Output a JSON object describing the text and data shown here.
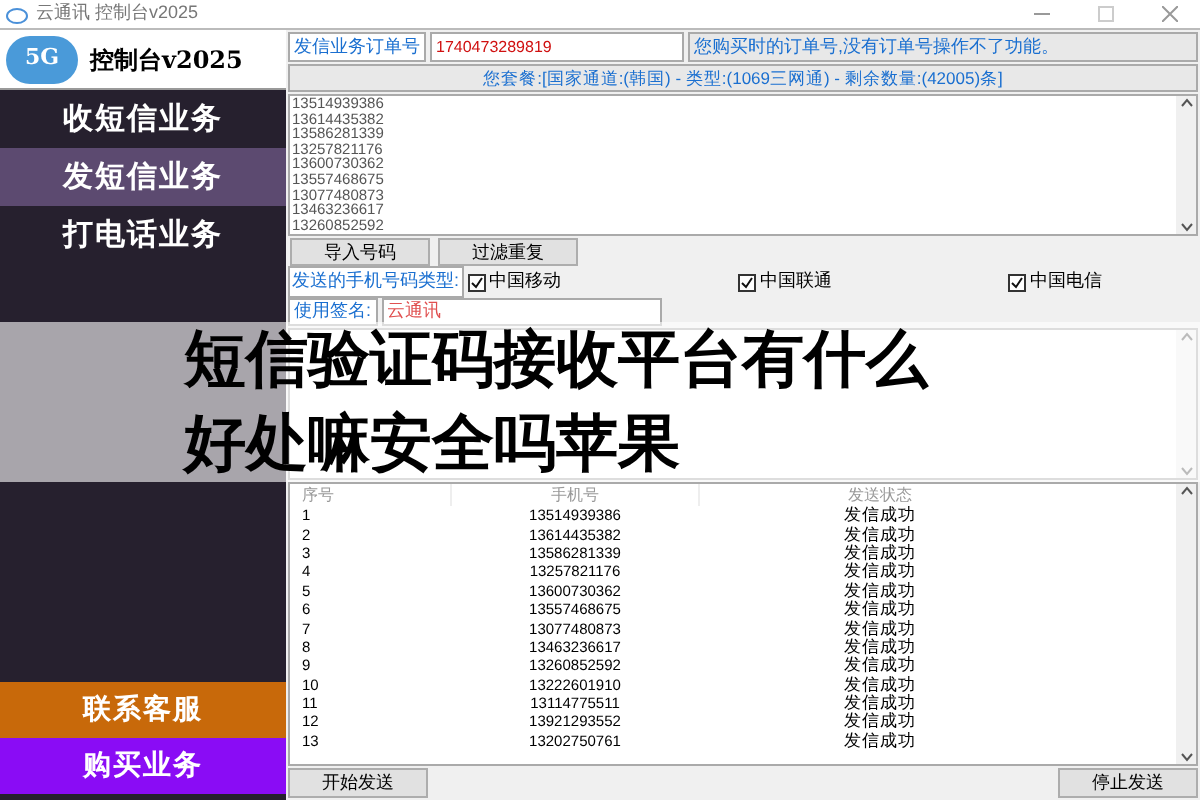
{
  "window": {
    "title": "云通讯 控制台v2025"
  },
  "sidebar": {
    "logo_badge": "5G",
    "logo_text": "控制台v2025",
    "items": [
      {
        "label": "收短信业务",
        "selected": false
      },
      {
        "label": "发短信业务",
        "selected": true
      },
      {
        "label": "打电话业务",
        "selected": false
      }
    ],
    "actions": [
      {
        "label": "联系客服",
        "color": "#c8690a"
      },
      {
        "label": "购买业务",
        "color": "#8a0cf5"
      }
    ]
  },
  "order": {
    "label": "发信业务订单号",
    "value": "1740473289819",
    "hint": "您购买时的订单号,没有订单号操作不了功能。"
  },
  "package_info": "您套餐:[国家通道:(韩国) - 类型:(1069三网通) - 剩余数量:(42005)条]",
  "numbers": [
    "13514939386",
    "13614435382",
    "13586281339",
    "13257821176",
    "13600730362",
    "13557468675",
    "13077480873",
    "13463236617",
    "13260852592"
  ],
  "buttons": [
    "导入号码",
    "过滤重复"
  ],
  "carrier_type": {
    "label": "发送的手机号码类型:",
    "options": [
      {
        "label": "中国移动",
        "checked": true
      },
      {
        "label": "中国联通",
        "checked": true
      },
      {
        "label": "中国电信",
        "checked": true
      }
    ]
  },
  "signature": {
    "label": "使用签名:",
    "value": "云通讯"
  },
  "table": {
    "columns": [
      "序号",
      "手机号",
      "发送状态"
    ],
    "rows": [
      [
        "1",
        "13514939386",
        "发信成功"
      ],
      [
        "2",
        "13614435382",
        "发信成功"
      ],
      [
        "3",
        "13586281339",
        "发信成功"
      ],
      [
        "4",
        "13257821176",
        "发信成功"
      ],
      [
        "5",
        "13600730362",
        "发信成功"
      ],
      [
        "6",
        "13557468675",
        "发信成功"
      ],
      [
        "7",
        "13077480873",
        "发信成功"
      ],
      [
        "8",
        "13463236617",
        "发信成功"
      ],
      [
        "9",
        "13260852592",
        "发信成功"
      ],
      [
        "10",
        "13222601910",
        "发信成功"
      ],
      [
        "11",
        "13114775511",
        "发信成功"
      ],
      [
        "12",
        "13921293552",
        "发信成功"
      ],
      [
        "13",
        "13202750761",
        "发信成功"
      ]
    ]
  },
  "footer_buttons": [
    "开始发送",
    "停止发送"
  ],
  "headline": [
    "短信验证码接收平台有什么",
    "好处嘛安全吗苹果"
  ]
}
